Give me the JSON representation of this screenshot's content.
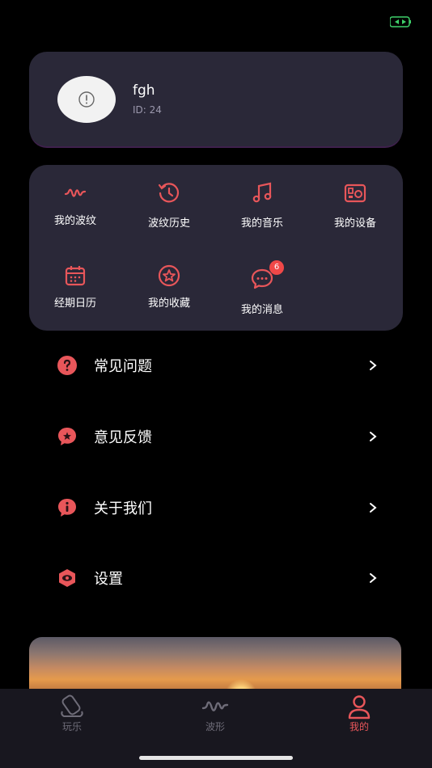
{
  "status_bar": {
    "icon": "battery-charging-icon"
  },
  "profile": {
    "username": "fgh",
    "id_text": "ID: 24",
    "avatar_icon": "avatar-placeholder-icon"
  },
  "menu": {
    "items": [
      {
        "label": "我的波纹",
        "icon": "wave-icon"
      },
      {
        "label": "波纹历史",
        "icon": "history-icon"
      },
      {
        "label": "我的音乐",
        "icon": "music-note-icon"
      },
      {
        "label": "我的设备",
        "icon": "device-icon"
      },
      {
        "label": "经期日历",
        "icon": "calendar-icon"
      },
      {
        "label": "我的收藏",
        "icon": "star-icon"
      },
      {
        "label": "我的消息",
        "icon": "message-icon",
        "badge": "6"
      }
    ]
  },
  "list": {
    "items": [
      {
        "label": "常见问题",
        "icon": "question-icon"
      },
      {
        "label": "意见反馈",
        "icon": "feedback-icon"
      },
      {
        "label": "关于我们",
        "icon": "info-icon"
      },
      {
        "label": "设置",
        "icon": "settings-icon"
      }
    ]
  },
  "tabbar": {
    "tabs": [
      {
        "label": "玩乐",
        "icon": "play-icon",
        "active": false
      },
      {
        "label": "波形",
        "icon": "waveform-icon",
        "active": false
      },
      {
        "label": "我的",
        "icon": "profile-icon",
        "active": true
      }
    ]
  },
  "colors": {
    "accent": "#e8565a",
    "card": "#2a2838",
    "tab_inactive": "#6e6c78"
  }
}
